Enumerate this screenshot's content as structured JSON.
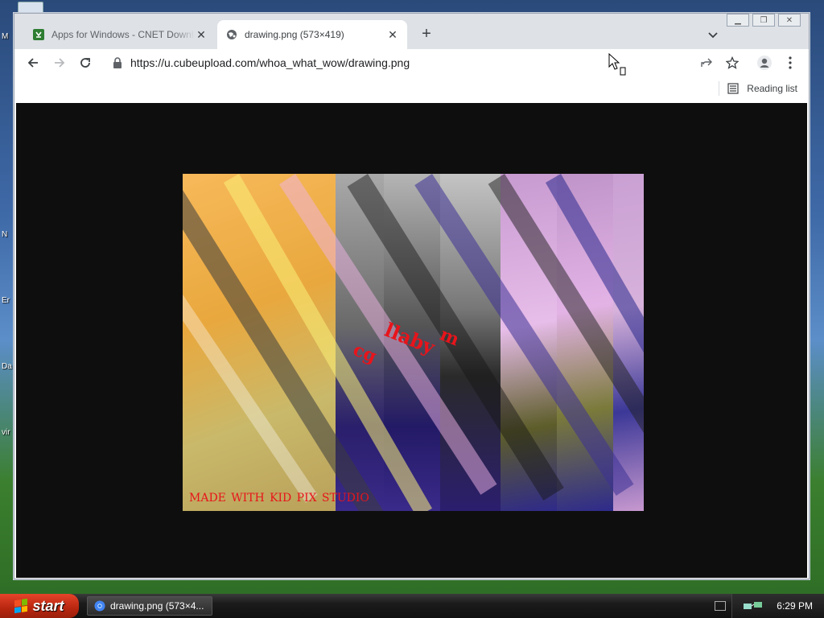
{
  "desktop": {
    "labels": [
      "M",
      "N",
      "Er",
      "Da",
      "vir"
    ]
  },
  "browser": {
    "tabs": [
      {
        "title": "Apps for Windows - CNET Download",
        "icon": "cnet-download-icon",
        "favicon_color": "#2e7d32"
      },
      {
        "title": "drawing.png (573×419)",
        "icon": "globe-icon"
      }
    ],
    "address": "https://u.cubeupload.com/whoa_what_wow/drawing.png",
    "reading_list_label": "Reading list"
  },
  "image": {
    "caption": "made with kid pix studio",
    "words": [
      "cg",
      "llaby",
      "m"
    ]
  },
  "taskbar": {
    "start_label": "start",
    "item_label": "drawing.png (573×4...",
    "clock": "6:29 PM"
  },
  "colors": {
    "accent_red": "#e8141b",
    "start_green": "#2e8b2e",
    "page_bg": "#0e0e0e"
  }
}
